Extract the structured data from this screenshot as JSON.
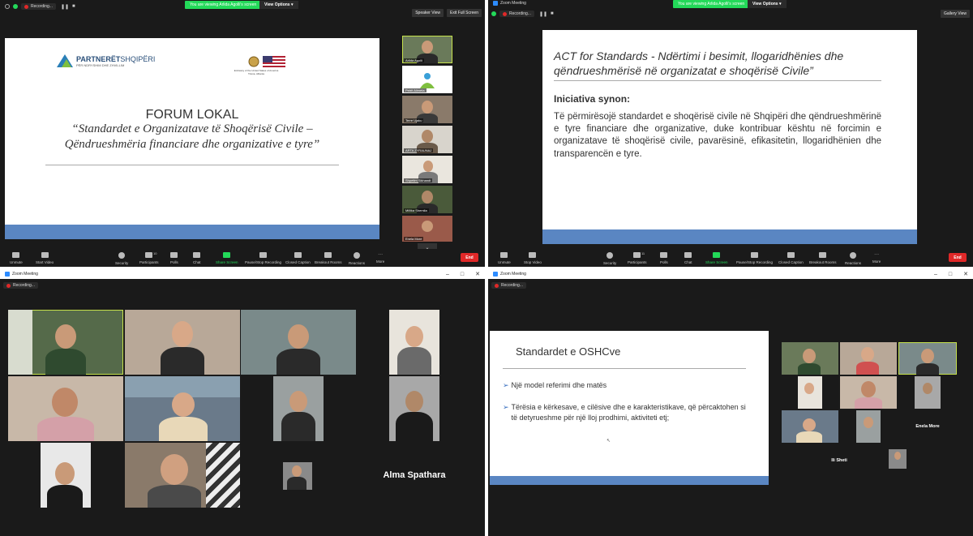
{
  "q1": {
    "recording": "Recording...",
    "viewing_banner": "You are viewing Arlida Agolli's screen",
    "view_options": "View Options",
    "speaker_view": "Speaker View",
    "exit_full_screen": "Exit Full Screen",
    "logo_bold": "PARTNERËT",
    "logo_light": "SHQIPËRI",
    "logo_tagline": "PËR NDRYSHIM DHE ZHVILLIM",
    "embassy_caption": "Embassy of the United States of America\nTirana, Albania",
    "slide_title": "FORUM LOKAL",
    "slide_subtitle_1": "“Standardet e Organizatave të Shoqërisë Civile –",
    "slide_subtitle_2": "Qëndrueshmëria financiare dhe organizative e tyre”",
    "thumbs": [
      "Arlida Agolli",
      "Petrit Alimeta",
      "Terre Ujaku",
      "ARTA ZYRAUNAJ",
      "Shpetim Sikhandt",
      "Millika Shemila",
      "Enela More"
    ],
    "toolbar": [
      "Unmute",
      "Start Video",
      "Security",
      "Participants",
      "Polls",
      "Chat",
      "Share Screen",
      "Pause/Stop Recording",
      "Closed Caption",
      "Breakout Rooms",
      "Reactions",
      "More"
    ],
    "participants_count": "10",
    "end": "End"
  },
  "q2": {
    "window_title": "Zoom Meeting",
    "recording": "Recording...",
    "viewing_banner": "You are viewing Arlida Agolli's screen",
    "view_options": "View Options",
    "gallery_view": "Gallery View",
    "slide_title_1": "ACT for Standards - Ndërtimi i besimit, llogaridhënies dhe",
    "slide_title_2": "qëndrueshmërisë në organizatat e shoqërisë Civile”",
    "slide_heading": "Iniciativa synon:",
    "slide_body": "Të përmirësojë standardet e shoqërisë civile në Shqipëri dhe qëndrueshmërinë e tyre financiare dhe organizative, duke kontribuar kështu në forcimin e organizatave të shoqërisë civile, pavarësinë, efikasitetin, llogaridhënien dhe transparencën e tyre.",
    "toolbar": [
      "Unmute",
      "Stop Video",
      "Security",
      "Participants",
      "Polls",
      "Chat",
      "Share Screen",
      "Pause/Stop Recording",
      "Closed Caption",
      "Breakout Rooms",
      "Reactions",
      "More"
    ],
    "participants_count": "11",
    "end": "End"
  },
  "q3": {
    "window_title": "Zoom Meeting",
    "recording": "Recording...",
    "name_tile": "Alma Spathara"
  },
  "q4": {
    "window_title": "Zoom Meeting",
    "recording": "Recording...",
    "slide_title": "Standardet e OSHCve",
    "bullet_1": "Një model referimi dhe matës",
    "bullet_2": "Tërësia e kërkesave, e cilësive dhe e karakteristikave, që përcaktohen si të detyrueshme për një lloj prodhimi, aktiviteti etj;",
    "name_1": "Enela More",
    "name_2": "Ili Sheti"
  }
}
